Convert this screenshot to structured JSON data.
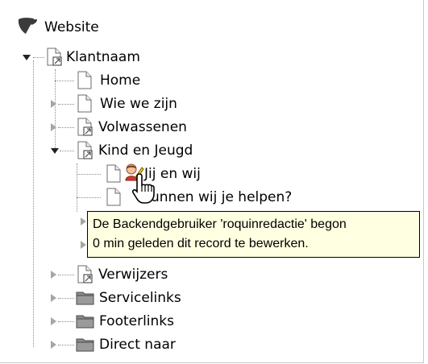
{
  "tree": {
    "root": {
      "label": "Website",
      "icon": "typo3-logo-icon"
    },
    "nodes": [
      {
        "id": "klantnaam",
        "label": "Klantnaam",
        "icon": "page-shortcut-icon",
        "state": "expanded"
      },
      {
        "id": "home",
        "label": "Home",
        "icon": "page-icon",
        "state": "leaf"
      },
      {
        "id": "wie-we-zijn",
        "label": "Wie we zijn",
        "icon": "page-icon",
        "state": "collapsed"
      },
      {
        "id": "volwassenen",
        "label": "Volwassenen",
        "icon": "page-shortcut-icon",
        "state": "collapsed"
      },
      {
        "id": "kind-en-jeugd",
        "label": "Kind en Jeugd",
        "icon": "page-shortcut-icon",
        "state": "expanded"
      },
      {
        "id": "jij-en-wij",
        "label": "Jij en wij",
        "icon": "page-icon",
        "state": "leaf",
        "badge": "user-editing-icon"
      },
      {
        "id": "kunnen-wij",
        "label": "unnen wij je helpen?",
        "icon": "page-icon",
        "state": "leaf"
      },
      {
        "id": "hidden-1",
        "label": "",
        "icon": "page-icon",
        "state": "collapsed"
      },
      {
        "id": "hidden-2",
        "label": "",
        "icon": "page-icon",
        "state": "collapsed"
      },
      {
        "id": "verwijzers",
        "label": "Verwijzers",
        "icon": "page-shortcut-icon",
        "state": "collapsed"
      },
      {
        "id": "servicelinks",
        "label": "Servicelinks",
        "icon": "folder-icon",
        "state": "collapsed"
      },
      {
        "id": "footerlinks",
        "label": "Footerlinks",
        "icon": "folder-icon",
        "state": "collapsed"
      },
      {
        "id": "direct-naar",
        "label": "Direct naar",
        "icon": "folder-icon",
        "state": "collapsed"
      }
    ]
  },
  "tooltip": {
    "line1": "De Backendgebruiker 'roquinredactie' begon",
    "line2": "0 min geleden dit record te bewerken."
  },
  "cursor": {
    "icon": "hand-pointer-icon"
  }
}
